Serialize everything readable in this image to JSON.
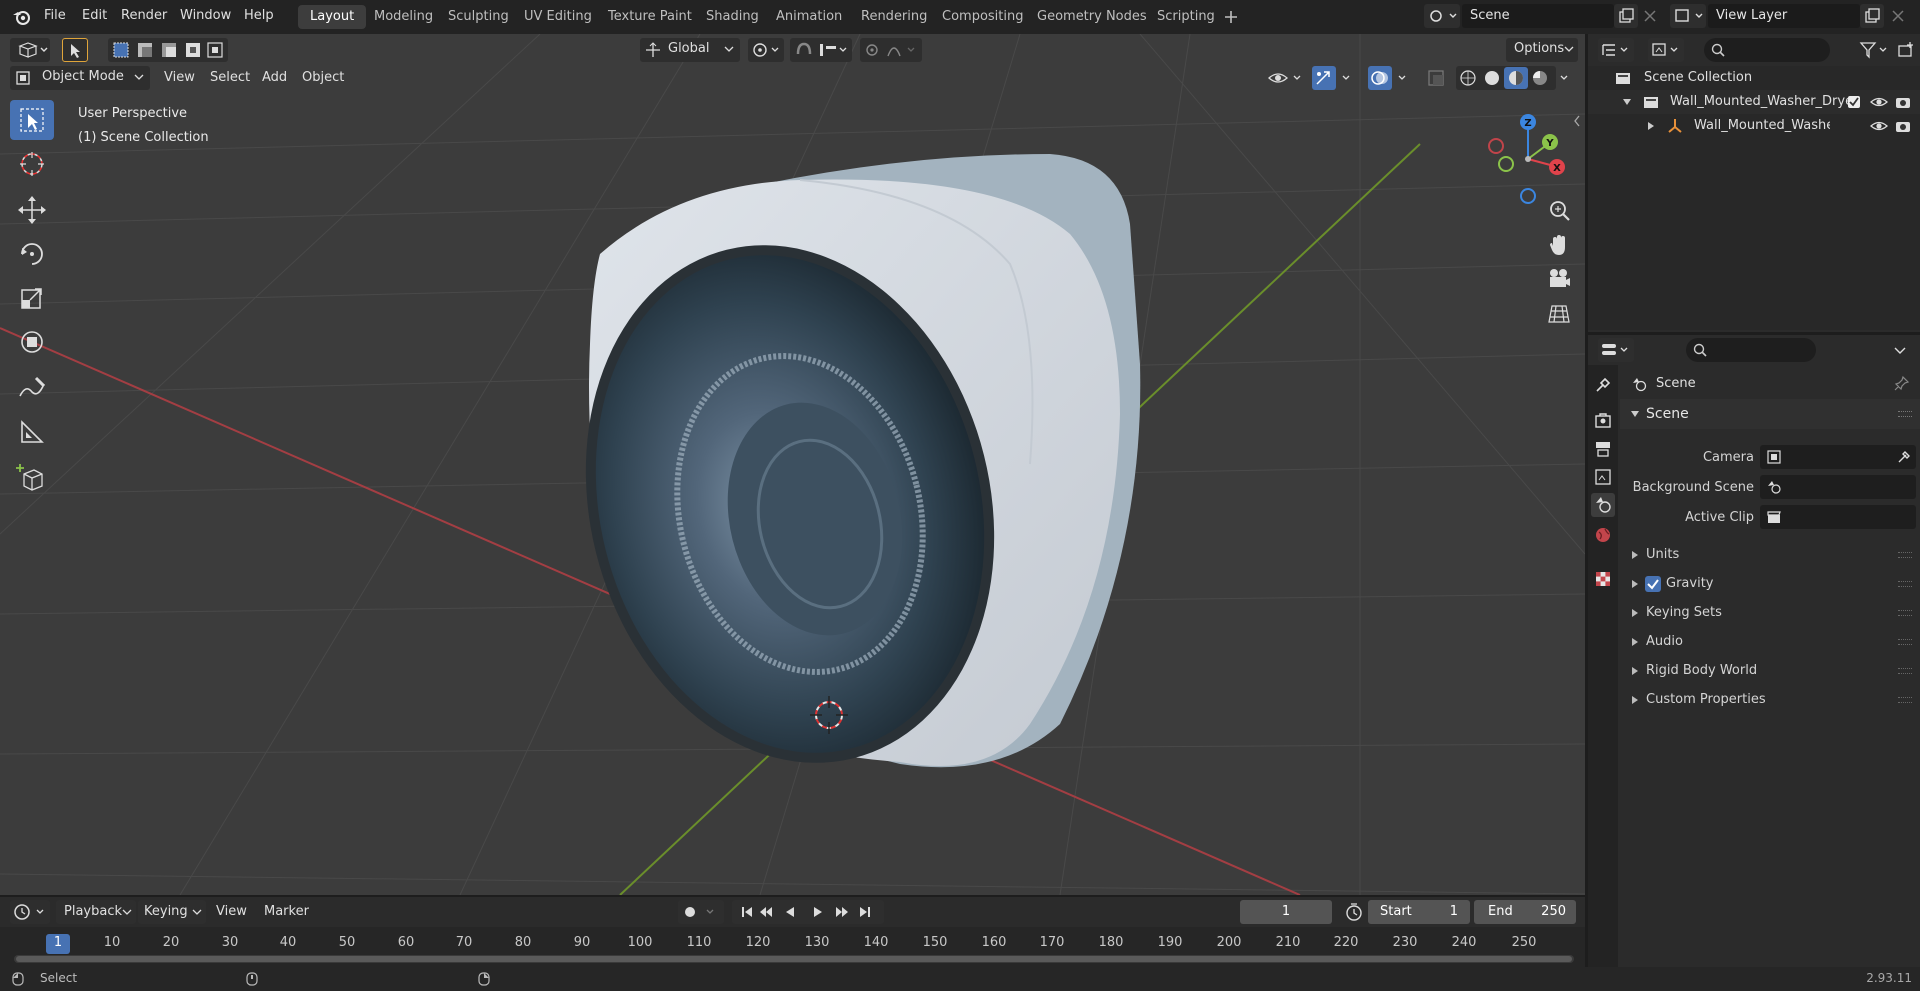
{
  "topbar": {
    "menus": [
      "File",
      "Edit",
      "Render",
      "Window",
      "Help"
    ],
    "workspaces": [
      "Layout",
      "Modeling",
      "Sculpting",
      "UV Editing",
      "Texture Paint",
      "Shading",
      "Animation",
      "Rendering",
      "Compositing",
      "Geometry Nodes",
      "Scripting"
    ],
    "scene_name": "Scene",
    "view_layer_name": "View Layer"
  },
  "viewport_header": {
    "mode": "Object Mode",
    "menus": [
      "View",
      "Select",
      "Add",
      "Object"
    ],
    "transform_orientation": "Global",
    "options_label": "Options"
  },
  "viewport": {
    "perspective_label": "User Perspective",
    "collection_label": "(1) Scene Collection",
    "gizmo_axes": {
      "x": "X",
      "y": "Y",
      "z": "Z"
    }
  },
  "outliner": {
    "root": "Scene Collection",
    "items": [
      {
        "label": "Wall_Mounted_Washer_Dryer",
        "level": 1
      },
      {
        "label": "Wall_Mounted_Washer_D",
        "level": 2
      }
    ]
  },
  "properties": {
    "breadcrumb": "Scene",
    "panel_title": "Scene",
    "fields": [
      {
        "label": "Camera"
      },
      {
        "label": "Background Scene"
      },
      {
        "label": "Active Clip"
      }
    ],
    "subpanels": [
      "Units",
      "Gravity",
      "Keying Sets",
      "Audio",
      "Rigid Body World",
      "Custom Properties"
    ],
    "gravity_checked": true
  },
  "timeline": {
    "menus": [
      "Playback",
      "Keying",
      "View",
      "Marker"
    ],
    "current_frame": "1",
    "start_label": "Start",
    "start_value": "1",
    "end_label": "End",
    "end_value": "250",
    "ruler": [
      "1",
      "10",
      "20",
      "30",
      "40",
      "50",
      "60",
      "70",
      "80",
      "90",
      "100",
      "110",
      "120",
      "130",
      "140",
      "150",
      "160",
      "170",
      "180",
      "190",
      "200",
      "210",
      "220",
      "230",
      "240",
      "250"
    ]
  },
  "statusbar": {
    "left_label": "Select",
    "version": "2.93.11"
  },
  "colors": {
    "accent": "#4772b3",
    "x_axis": "#e0434b",
    "y_axis": "#8bc34a",
    "z_axis": "#3b86e0"
  }
}
